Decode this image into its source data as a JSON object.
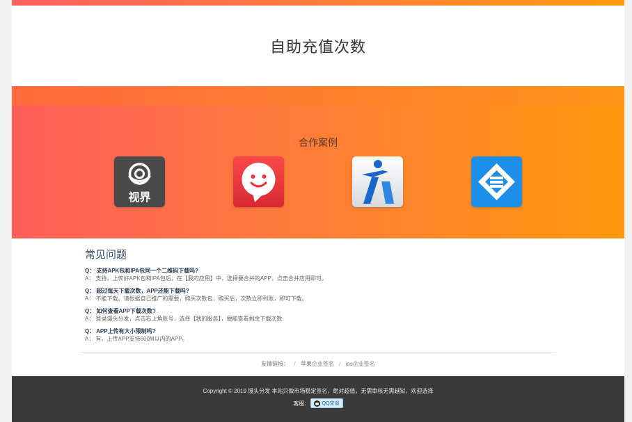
{
  "header": {
    "title": "自助充值次数"
  },
  "cases": {
    "title": "合作案例",
    "apps": [
      {
        "icon": "shijie-app-icon",
        "label": "视界"
      },
      {
        "icon": "smiley-chat-app-icon",
        "label": ""
      },
      {
        "icon": "blue-k-app-icon",
        "label": ""
      },
      {
        "icon": "blue-cube-app-icon",
        "label": ""
      }
    ]
  },
  "faq": {
    "heading": "常见问题",
    "items": [
      {
        "q": "Q： 支持APK包和IPA包同一个二维码下载吗?",
        "a": "A： 支持。上传好APK包和IPA包后，在【我的应用】中，选择要合并的APP，点击合并应用即可。"
      },
      {
        "q": "Q： 超过每天下载次数，APP还能下载吗?",
        "a": "A： 不能下载。请根据自己推广的需要，购买次数包，购买后，次数立即到账，即可下载。"
      },
      {
        "q": "Q： 如何查看APP下载次数?",
        "a": "A： 登录馒头分发，点击右上角账号，选择【我的服务】，便能查看剩余下载次数"
      },
      {
        "q": "Q： APP上传有大小限制吗?",
        "a": "A： 有。上传APP支持600M以内的APP。"
      }
    ]
  },
  "links": {
    "label": "友情链接：",
    "sep": "/",
    "items": [
      "苹果企业签名",
      "ios企业签名"
    ]
  },
  "footer": {
    "copyright": "Copyright © 2019 馒头分发    本站只做市场稳定签名，绝对超值，无需审核无需越狱，欢迎选择",
    "service_label": "客服:",
    "qq_label": "QQ交谈"
  },
  "colors": {
    "accent_orange": "#ff8a1f",
    "accent_red": "#fe5d5a",
    "footer_bg": "#3a3a3a"
  }
}
